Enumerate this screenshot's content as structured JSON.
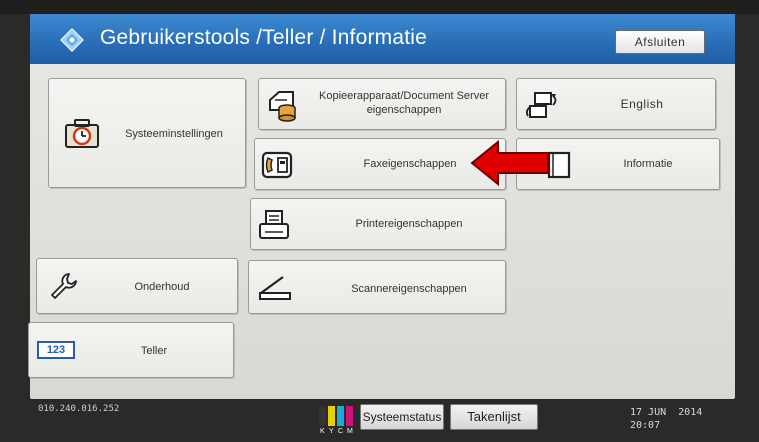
{
  "header": {
    "title": "Gebruikerstools /Teller / Informatie",
    "exit_label": "Afsluiten"
  },
  "buttons": {
    "system_settings": "Systeeminstellingen",
    "copier_props": "Kopieerapparaat/Document Server eigenschappen",
    "fax_props": "Faxeigenschappen",
    "printer_props": "Printereigenschappen",
    "scanner_props": "Scannereigenschappen",
    "english": "English",
    "information": "Informatie",
    "maintenance": "Onderhoud",
    "counter": "Teller",
    "counter_icon_text": "123"
  },
  "footer": {
    "ip_address": "010.240.016.252",
    "toner_letters": [
      "K",
      "Y",
      "C",
      "M"
    ],
    "system_status": "Systeemstatus",
    "job_list": "Takenlijst",
    "date": "17 JUN  2014",
    "time": "20:07"
  },
  "colors": {
    "title_blue": "#2a6fb8",
    "arrow_red": "#e00000"
  }
}
